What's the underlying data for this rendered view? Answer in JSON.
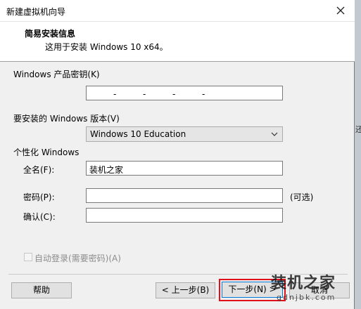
{
  "window": {
    "title": "新建虚拟机向导",
    "close_icon": "close-icon"
  },
  "header": {
    "title": "简易安装信息",
    "subtitle": "这用于安装 Windows 10 x64。"
  },
  "product_key": {
    "label": "Windows 产品密钥(K)",
    "dashes": [
      "-",
      "-",
      "-",
      "-"
    ]
  },
  "edition": {
    "label": "要安装的 Windows 版本(V)",
    "selected": "Windows 10 Education"
  },
  "personalize": {
    "label": "个性化 Windows",
    "fullname_label": "全名(F):",
    "fullname_value": "装机之家",
    "password_label": "密码(P):",
    "password_value": "",
    "optional_note": "(可选)",
    "confirm_label": "确认(C):",
    "confirm_value": ""
  },
  "autologin": {
    "label": "自动登录(需要密码)(A)",
    "checked": false
  },
  "buttons": {
    "help": "帮助",
    "back": "< 上一步(B)",
    "next": "下一步(N) >",
    "cancel": "取消"
  },
  "side_glyph": "还",
  "watermark": {
    "title": "装机之家",
    "url": "gdnjbk.com"
  }
}
